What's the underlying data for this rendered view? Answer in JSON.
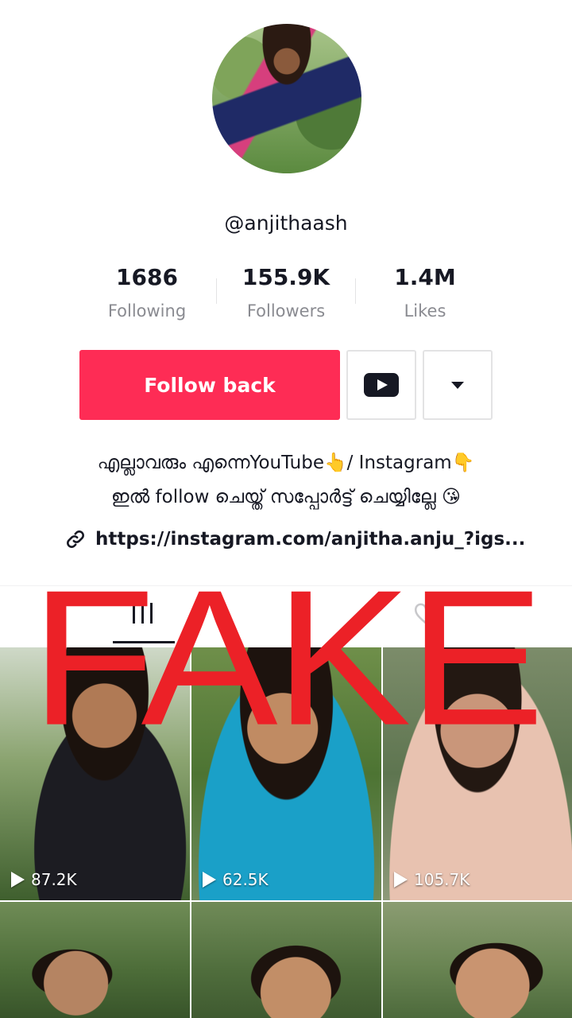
{
  "profile": {
    "username": "@anjithaash",
    "avatar_icon": "profile-photo"
  },
  "stats": [
    {
      "value": "1686",
      "label": "Following"
    },
    {
      "value": "155.9K",
      "label": "Followers"
    },
    {
      "value": "1.4M",
      "label": "Likes"
    }
  ],
  "actions": {
    "follow_label": "Follow back",
    "youtube_icon": "youtube-icon",
    "more_icon": "caret-down-icon"
  },
  "bio": {
    "line1": "എല്ലാവരും എന്നെYouTube👆/ Instagram👇",
    "line2": "ഇൽ follow ചെയ്ത് സപ്പോർട്ട് ചെയ്യില്ലേ 😘",
    "link": "https://instagram.com/anjitha.anju_?igs..."
  },
  "tabs": {
    "active": "videos-grid-icon",
    "other": "liked-heart-icon"
  },
  "overlay": {
    "stamp_text": "FAKE",
    "stamp_color": "#ec2127"
  },
  "videos": [
    {
      "views": "87.2K"
    },
    {
      "views": "62.5K"
    },
    {
      "views": "105.7K"
    },
    {
      "views": ""
    },
    {
      "views": ""
    },
    {
      "views": ""
    }
  ],
  "colors": {
    "accent": "#fe2c55",
    "text": "#161823",
    "muted": "#8a8b91"
  }
}
